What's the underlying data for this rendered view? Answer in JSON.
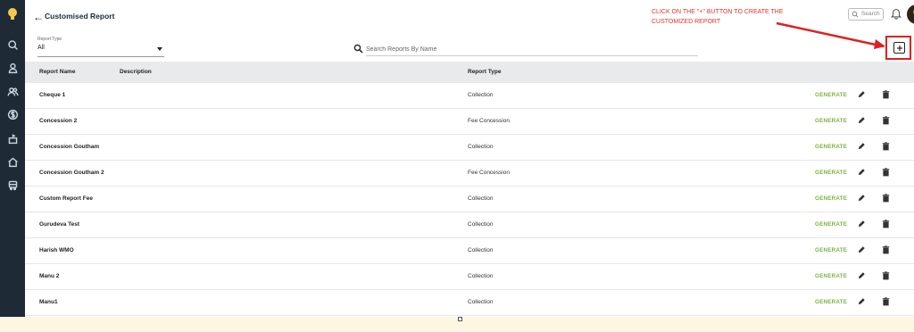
{
  "header": {
    "title": "Customised Report",
    "search_placeholder": "Search"
  },
  "annotation": {
    "line1": "CLICK ON THE \"+\" BUTTON TO CREATE THE",
    "line2": "CUSTOMIZED REPORT",
    "color": "#e53030"
  },
  "filter": {
    "label": "Report Type",
    "value": "All"
  },
  "search": {
    "placeholder": "Search Reports By Name"
  },
  "table": {
    "columns": {
      "name": "Report Name",
      "description": "Description",
      "type": "Report Type"
    },
    "generate_label": "GENERATE",
    "rows": [
      {
        "name": "Cheque 1",
        "type": "Collection"
      },
      {
        "name": "Concession 2",
        "type": "Fee Concession"
      },
      {
        "name": "Concession Goutham",
        "type": "Collection"
      },
      {
        "name": "Concession Goutham 2",
        "type": "Fee Concession"
      },
      {
        "name": "Custom Report Fee",
        "type": "Collection"
      },
      {
        "name": "Gurudeva Test",
        "type": "Collection"
      },
      {
        "name": "Harish WMO",
        "type": "Collection"
      },
      {
        "name": "Manu 2",
        "type": "Collection"
      },
      {
        "name": "Manu1",
        "type": "Collection"
      }
    ]
  },
  "sidebar": {
    "icons": [
      "search-icon",
      "user-icon",
      "users-icon",
      "dollar-icon",
      "fee-structure-icon",
      "home-icon",
      "transport-icon"
    ]
  },
  "colors": {
    "sidebar": "#1e2a36",
    "generate": "#7cb342",
    "highlight": "#e02020",
    "header_row": "#e9eaec"
  }
}
